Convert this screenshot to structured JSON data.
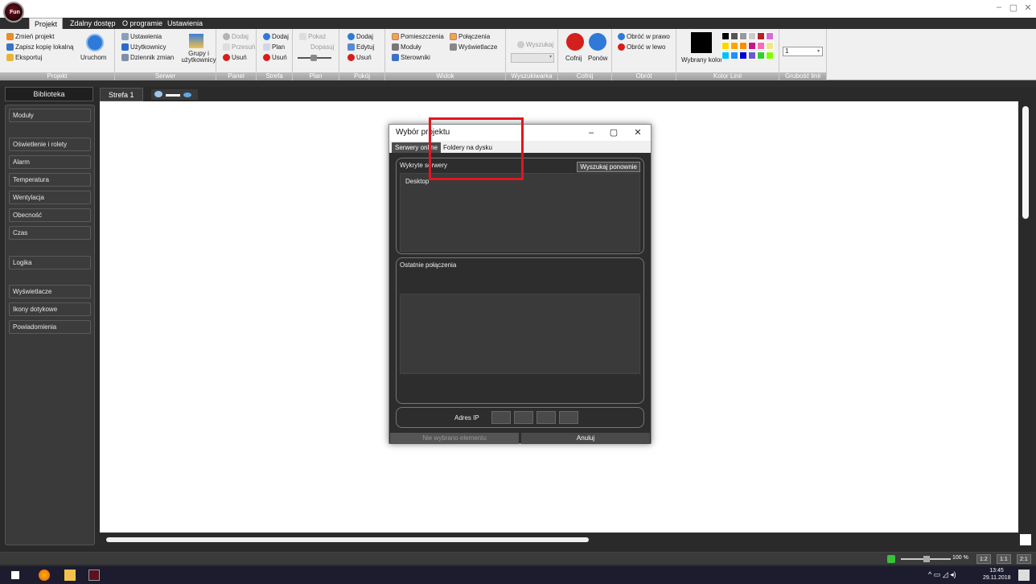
{
  "app": {
    "logo_text": "Fun"
  },
  "window": {
    "minimize": "–",
    "maximize": "▢",
    "close": "✕"
  },
  "menu_tabs": [
    "Projekt",
    "Zdalny dostęp",
    "O programie",
    "Ustawienia"
  ],
  "ribbon": {
    "projekt": {
      "label": "Projekt",
      "change": "Zmień projekt",
      "save_copy": "Zapisz kopię lokalną",
      "export": "Eksportuj",
      "run": "Uruchom"
    },
    "serwer": {
      "label": "Serwer",
      "settings": "Ustawienia",
      "users": "Użytkownicy",
      "changelog": "Dziennik zmian",
      "groups": "Grupy i użytkownicy"
    },
    "panel": {
      "label": "Panel",
      "add": "Dodaj",
      "move": "Przesuń",
      "remove": "Usuń"
    },
    "strefa": {
      "label": "Strefa",
      "add": "Dodaj",
      "plan": "Plan",
      "remove": "Usuń"
    },
    "plan": {
      "label": "Plan",
      "show": "Pokaż",
      "fit": "Dopasuj"
    },
    "pokoj": {
      "label": "Pokój",
      "add": "Dodaj",
      "edit": "Edytuj",
      "remove": "Usuń"
    },
    "widok": {
      "label": "Widok",
      "rooms": "Pomieszczenia",
      "connections": "Połączenia",
      "modules": "Moduły",
      "displays": "Wyświetlacze",
      "controllers": "Sterowniki"
    },
    "wyszukiwarka": {
      "label": "Wyszukiwarka",
      "search": "Wyszukaj"
    },
    "cofnij": {
      "label": "Cofnij",
      "undo": "Cofnij",
      "redo": "Ponów"
    },
    "obrot": {
      "label": "Obrót",
      "cw": "Obróć w prawo",
      "ccw": "Obróć w lewo"
    },
    "kolor": {
      "label": "Kolor Linii",
      "selected": "Wybrany kolor",
      "swatches": [
        "#000000",
        "#555555",
        "#999999",
        "#cccccc",
        "#b22222",
        "#d96ad9",
        "#ffd700",
        "#ffa500",
        "#ff8c00",
        "#c71585",
        "#ff69b4",
        "#f0e68c",
        "#00bfff",
        "#1e90ff",
        "#0000cd",
        "#6a5acd",
        "#32cd32",
        "#7fff00"
      ]
    },
    "grubosc": {
      "label": "Grubość linii",
      "value": "1"
    }
  },
  "sidebar": {
    "header": "Biblioteka",
    "items": [
      "Moduły",
      "Oświetlenie i rolety",
      "Alarm",
      "Temperatura",
      "Wentylacja",
      "Obecność",
      "Czas",
      "Logika",
      "Wyświetlacze",
      "Ikony dotykowe",
      "Powiadomienia"
    ]
  },
  "canvas": {
    "tab": "Strefa 1"
  },
  "dialog": {
    "title": "Wybór projektu",
    "tabs": [
      "Serwery online",
      "Foldery na dysku"
    ],
    "found_label": "Wykryte serwery",
    "rescan": "Wyszukaj ponownie",
    "servers": [
      "Desktop"
    ],
    "recent_label": "Ostatnie połączenia",
    "ip_label": "Adres IP",
    "no_selection": "Nie wybrano elementu",
    "cancel": "Anuluj"
  },
  "status": {
    "zoom": "100 %",
    "z1": "1:2",
    "z2": "1:1",
    "z3": "2:1"
  },
  "taskbar": {
    "time": "13:45",
    "date": "29.11.2018"
  }
}
